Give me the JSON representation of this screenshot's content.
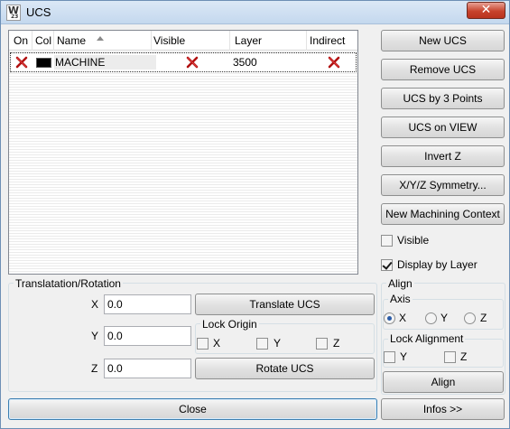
{
  "window": {
    "title": "UCS",
    "icon_letter": "W",
    "icon_sub": "23",
    "close_glyph": "✕"
  },
  "list": {
    "columns": [
      "On",
      "Col",
      "Name",
      "Visible",
      "Layer",
      "Indirect"
    ],
    "rows": [
      {
        "on": "off",
        "color": "#000000",
        "name": "MACHINE",
        "visible": "off",
        "layer": "3500",
        "indirect": "off"
      }
    ]
  },
  "buttons": {
    "new_ucs": "New UCS",
    "remove_ucs": "Remove UCS",
    "ucs_by_3_points": "UCS by 3 Points",
    "ucs_on_view": "UCS on VIEW",
    "invert_z": "Invert Z",
    "xyz_symmetry": "X/Y/Z Symmetry...",
    "new_machining_context": "New Machining Context",
    "translate_ucs": "Translate UCS",
    "rotate_ucs": "Rotate UCS",
    "align": "Align",
    "close": "Close",
    "infos": "Infos >>"
  },
  "options": {
    "visible_label": "Visible",
    "visible_checked": false,
    "display_by_layer_label": "Display by Layer",
    "display_by_layer_checked": true
  },
  "translation": {
    "group_label": "Translatation/Rotation",
    "x_label": "X",
    "x_value": "0.0",
    "y_label": "Y",
    "y_value": "0.0",
    "z_label": "Z",
    "z_value": "0.0",
    "lock_origin_label": "Lock Origin",
    "lock_x": "X",
    "lock_y": "Y",
    "lock_z": "Z"
  },
  "align": {
    "group_label": "Align",
    "axis_label": "Axis",
    "axis_x": "X",
    "axis_y": "Y",
    "axis_z": "Z",
    "axis_selected": "X",
    "lock_alignment_label": "Lock Alignment",
    "lock_y": "Y",
    "lock_z": "Z"
  }
}
